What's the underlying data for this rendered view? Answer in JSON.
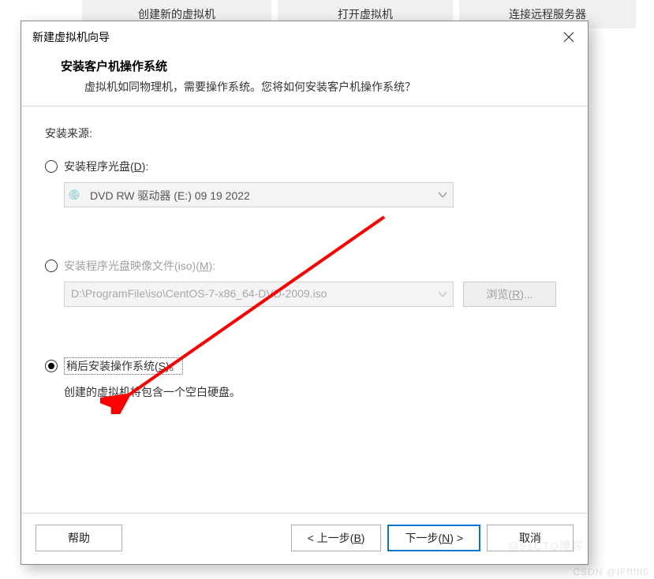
{
  "background": {
    "btn1": "创建新的虚拟机",
    "btn2": "打开虚拟机",
    "btn3": "连接远程服务器"
  },
  "dialog": {
    "title": "新建虚拟机向导",
    "header": {
      "title": "安装客户机操作系统",
      "subtitle": "虚拟机如同物理机，需要操作系统。您将如何安装客户机操作系统？"
    },
    "body": {
      "source_label": "安装来源:",
      "opt1": {
        "label": "安装程序光盘(D):",
        "value": "DVD RW 驱动器 (E:) 09 19 2022"
      },
      "opt2": {
        "label": "安装程序光盘映像文件(iso)(M):",
        "value": "D:\\ProgramFile\\iso\\CentOS-7-x86_64-DVD-2009.iso",
        "browse": "浏览(R)..."
      },
      "opt3": {
        "label": "稍后安装操作系统(S)。",
        "hint": "创建的虚拟机将包含一个空白硬盘。"
      }
    },
    "footer": {
      "help": "帮助",
      "back": "< 上一步(B)",
      "next": "下一步(N) >",
      "cancel": "取消"
    }
  },
  "watermark": "CSDN @IFfffff0",
  "watermark2": "@51CTO博客"
}
